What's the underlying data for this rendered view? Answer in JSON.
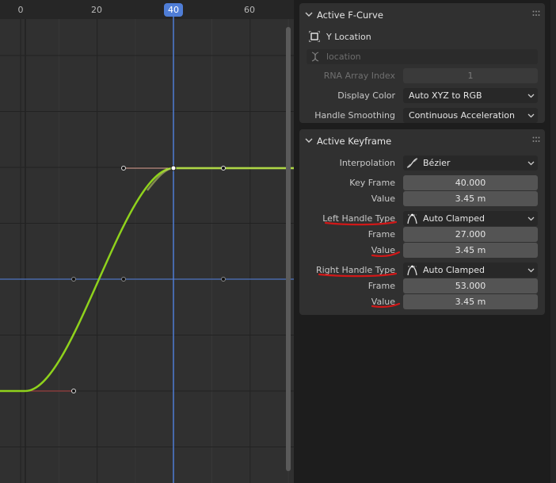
{
  "graph": {
    "x_ticks": [
      "0",
      "20",
      "40",
      "60"
    ],
    "current_frame": "40",
    "colors": {
      "background": "#303030",
      "grid_major": "#222222",
      "grid_minor": "#383838",
      "curve": "#8fd21c",
      "playhead": "#4f7dd6",
      "cursor_line": "#4868a8"
    }
  },
  "active_fcurve": {
    "title": "Active F-Curve",
    "channel_name": "Y Location",
    "data_path_placeholder": "location",
    "rna_array_index_label": "RNA Array Index",
    "rna_array_index_value": "1",
    "display_color_label": "Display Color",
    "display_color_value": "Auto XYZ to RGB",
    "handle_smoothing_label": "Handle Smoothing",
    "handle_smoothing_value": "Continuous Acceleration"
  },
  "active_keyframe": {
    "title": "Active Keyframe",
    "interpolation_label": "Interpolation",
    "interpolation_value": "Bézier",
    "key_frame_label": "Key Frame",
    "key_frame_value": "40.000",
    "value_label": "Value",
    "value_value": "3.45 m",
    "left_handle_type_label": "Left Handle Type",
    "left_handle_type_value": "Auto Clamped",
    "left_frame_label": "Frame",
    "left_frame_value": "27.000",
    "left_value_label": "Value",
    "left_value_value": "3.45 m",
    "right_handle_type_label": "Right Handle Type",
    "right_handle_type_value": "Auto Clamped",
    "right_frame_label": "Frame",
    "right_frame_value": "53.000",
    "right_value_label": "Value",
    "right_value_value": "3.45 m"
  },
  "annotations": {
    "underline_color": "#d01818"
  }
}
